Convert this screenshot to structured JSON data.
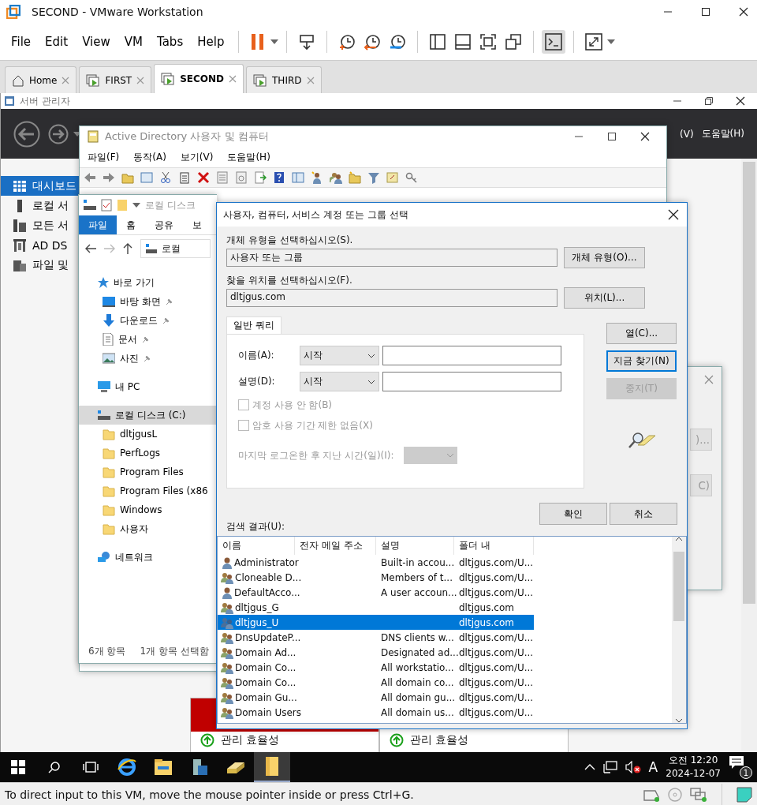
{
  "vmware": {
    "title": "SECOND - VMware Workstation",
    "menu": [
      "File",
      "Edit",
      "View",
      "VM",
      "Tabs",
      "Help"
    ],
    "tabs": [
      {
        "label": "Home",
        "kind": "home",
        "selected": false
      },
      {
        "label": "FIRST",
        "kind": "vm",
        "selected": false
      },
      {
        "label": "SECOND",
        "kind": "vm",
        "selected": true
      },
      {
        "label": "THIRD",
        "kind": "vm",
        "selected": false
      }
    ],
    "status_text": "To direct input to this VM, move the mouse pointer inside or press Ctrl+G."
  },
  "server_manager": {
    "title": "서버 관리자",
    "menu": [
      "(V)",
      "도움말(H)"
    ],
    "nav": [
      {
        "label": "대시보드",
        "kind": "dashboard",
        "selected": true
      },
      {
        "label": "로컬 서",
        "kind": "server",
        "selected": false
      },
      {
        "label": "모든 서",
        "kind": "servers",
        "selected": false
      },
      {
        "label": "AD DS",
        "kind": "ad",
        "selected": false
      },
      {
        "label": "파일 및",
        "kind": "files",
        "selected": false
      }
    ],
    "tiles": [
      {
        "label": "관리 효율성",
        "alert": true
      },
      {
        "label": "관리 효율성"
      }
    ]
  },
  "ad_window": {
    "title": "Active Directory 사용자 및 컴퓨터",
    "menu": [
      "파일(F)",
      "동작(A)",
      "보기(V)",
      "도움말(H)"
    ]
  },
  "explorer": {
    "title": "로컬 디스크",
    "ribbon_tabs": [
      {
        "label": "파일",
        "selected": true
      },
      {
        "label": "홈",
        "selected": false
      },
      {
        "label": "공유",
        "selected": false
      },
      {
        "label": "보",
        "selected": false
      }
    ],
    "address": "로컬",
    "quick_access": "바로 가기",
    "pinned": [
      {
        "label": "바탕 화면",
        "kind": "desktop"
      },
      {
        "label": "다운로드",
        "kind": "download"
      },
      {
        "label": "문서",
        "kind": "document"
      },
      {
        "label": "사진",
        "kind": "picture"
      }
    ],
    "this_pc": "내 PC",
    "drive": {
      "label": "로컬 디스크 (C:)",
      "selected": true
    },
    "folders": [
      "dltjgusL",
      "PerfLogs",
      "Program Files",
      "Program Files (x86",
      "Windows",
      "사용자"
    ],
    "network": "네트워크",
    "status": [
      "6개 항목",
      "1개 항목 선택함"
    ]
  },
  "dialog": {
    "title": "사용자, 컴퓨터, 서비스 계정 또는 그룹 선택",
    "object_type": {
      "label": "개체 유형을 선택하십시오(S).",
      "value": "사용자 또는 그룹",
      "button": "개체 유형(O)..."
    },
    "location": {
      "label": "찾을 위치를 선택하십시오(F).",
      "value": "dltjgus.com",
      "button": "위치(L)..."
    },
    "query_tab": "일반 쿼리",
    "fields": [
      {
        "label": "이름(A):",
        "operator": "시작"
      },
      {
        "label": "설명(D):",
        "operator": "시작"
      }
    ],
    "checkboxes": [
      {
        "label": "계정 사용 안 함(B)",
        "checked": false,
        "disabled": true
      },
      {
        "label": "암호 사용 기간 제한 없음(X)",
        "checked": false,
        "disabled": true
      }
    ],
    "days_label": "마지막 로그온한 후 지난 시간(일)(I):",
    "side_buttons": [
      {
        "label": "열(C)...",
        "default": false,
        "disabled": false
      },
      {
        "label": "지금 찾기(N)",
        "default": true,
        "disabled": false
      },
      {
        "label": "중지(T)",
        "default": false,
        "disabled": true
      }
    ],
    "ok": "확인",
    "cancel": "취소",
    "results_label": "검색 결과(U):",
    "columns": [
      "이름",
      "전자 메일 주소",
      "설명",
      "폴더 내"
    ],
    "rows": [
      {
        "kind": "user",
        "name": "Administrator",
        "description": "Built-in accou...",
        "folder": "dltjgus.com/U...",
        "selected": false
      },
      {
        "kind": "group",
        "name": "Cloneable D...",
        "description": "Members of t...",
        "folder": "dltjgus.com/U...",
        "selected": false
      },
      {
        "kind": "user",
        "name": "DefaultAcco...",
        "description": "A user accoun...",
        "folder": "dltjgus.com/U...",
        "selected": false
      },
      {
        "kind": "group",
        "name": "dltjgus_G",
        "description": "",
        "folder": "dltjgus.com",
        "selected": false
      },
      {
        "kind": "group",
        "name": "dltjgus_U",
        "description": "",
        "folder": "dltjgus.com",
        "selected": true
      },
      {
        "kind": "group",
        "name": "DnsUpdateP...",
        "description": "DNS clients w...",
        "folder": "dltjgus.com/U...",
        "selected": false
      },
      {
        "kind": "group",
        "name": "Domain Ad...",
        "description": "Designated ad...",
        "folder": "dltjgus.com/U...",
        "selected": false
      },
      {
        "kind": "group",
        "name": "Domain Co...",
        "description": "All workstatio...",
        "folder": "dltjgus.com/U...",
        "selected": false
      },
      {
        "kind": "group",
        "name": "Domain Co...",
        "description": "All domain co...",
        "folder": "dltjgus.com/U...",
        "selected": false
      },
      {
        "kind": "group",
        "name": "Domain Gu...",
        "description": "All domain gu...",
        "folder": "dltjgus.com/U...",
        "selected": false
      },
      {
        "kind": "group",
        "name": "Domain Users",
        "description": "All domain us...",
        "folder": "dltjgus.com/U...",
        "selected": false
      }
    ]
  },
  "back_dialog": {
    "buttons": [
      ")...",
      "C)"
    ]
  },
  "taskbar": {
    "apps": [
      {
        "kind": "browser",
        "selected": false
      },
      {
        "kind": "files",
        "selected": false
      },
      {
        "kind": "server",
        "selected": false
      },
      {
        "kind": "tool",
        "selected": false
      },
      {
        "kind": "folder",
        "selected": true
      }
    ],
    "ime": "A",
    "time": "오전 12:20",
    "date": "2024-12-07",
    "notifications": "1"
  }
}
